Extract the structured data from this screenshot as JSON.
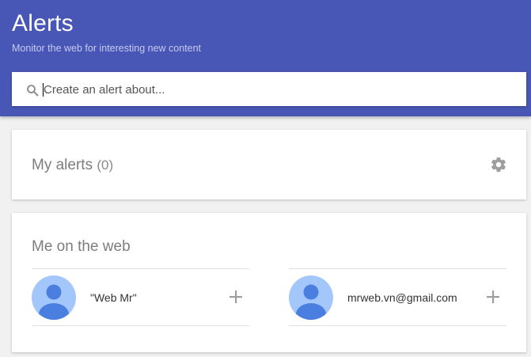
{
  "header": {
    "title": "Alerts",
    "subtitle": "Monitor the web for interesting new content"
  },
  "search": {
    "placeholder": "Create an alert about...",
    "value": "",
    "icon": "search-icon"
  },
  "my_alerts": {
    "title": "My alerts",
    "count": "(0)",
    "settings_icon": "gear-icon"
  },
  "me_on_web": {
    "title": "Me on the web",
    "suggestions": [
      {
        "label": "\"Web Mr\"",
        "icon": "avatar-icon",
        "action_icon": "plus-icon"
      },
      {
        "label": "mrweb.vn@gmail.com",
        "icon": "avatar-icon",
        "action_icon": "plus-icon"
      }
    ]
  },
  "colors": {
    "header_bg": "#4856b5",
    "page_bg": "#f1f1f1",
    "avatar_bg": "#a3c7fb",
    "avatar_fg": "#4a7fe0",
    "icon_gray": "#9e9e9e"
  }
}
